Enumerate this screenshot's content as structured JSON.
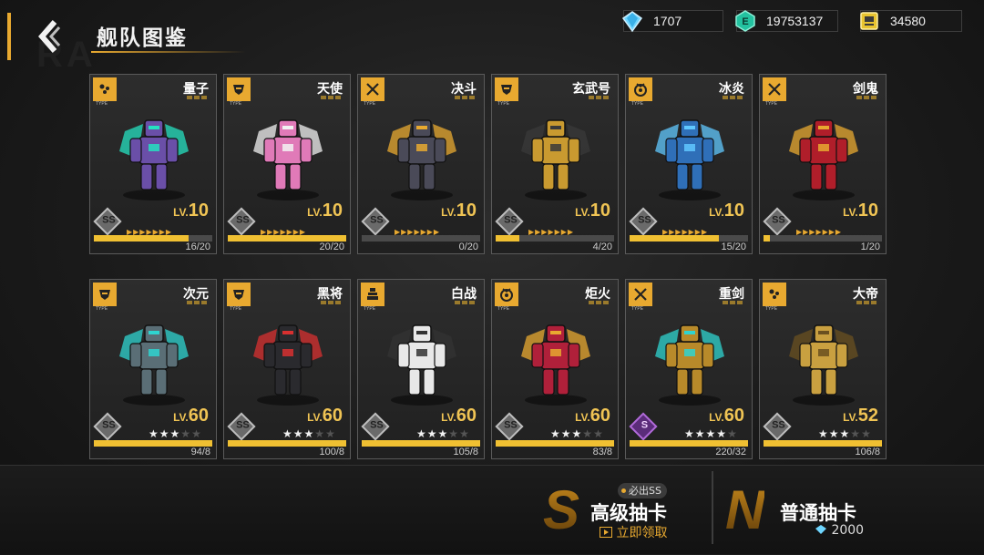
{
  "header": {
    "title": "舰队图鉴",
    "watermark": "RA"
  },
  "currencies": [
    {
      "icon": "diamond-icon",
      "value": "1707"
    },
    {
      "icon": "energy-coin-icon",
      "value": "19753137"
    },
    {
      "icon": "fuel-icon",
      "value": "34580"
    }
  ],
  "cards": [
    {
      "name": "量子",
      "type_icon": "dots-type-icon",
      "type_label": "TYPE",
      "rank": "SS",
      "lv_prefix": "LV.",
      "level": "10",
      "progress": "16/20",
      "fill": 0.8,
      "display": "chevrons",
      "mech_color": "#6a4fa8",
      "accent": "#25e0c0"
    },
    {
      "name": "天使",
      "type_icon": "helmet-type-icon",
      "type_label": "TYPE",
      "rank": "SS",
      "lv_prefix": "LV.",
      "level": "10",
      "progress": "20/20",
      "fill": 1.0,
      "display": "chevrons",
      "mech_color": "#e07ab8",
      "accent": "#f2f2f2"
    },
    {
      "name": "决斗",
      "type_icon": "swords-type-icon",
      "type_label": "TYPE",
      "rank": "SS",
      "lv_prefix": "LV.",
      "level": "10",
      "progress": "0/20",
      "fill": 0.0,
      "display": "chevrons",
      "mech_color": "#4a4a58",
      "accent": "#e8a930"
    },
    {
      "name": "玄武号",
      "type_icon": "helmet-type-icon",
      "type_label": "TYPE",
      "rank": "SS",
      "lv_prefix": "LV.",
      "level": "10",
      "progress": "4/20",
      "fill": 0.2,
      "display": "chevrons",
      "mech_color": "#c99a30",
      "accent": "#3a3a3a"
    },
    {
      "name": "冰炎",
      "type_icon": "shield-type-icon",
      "type_label": "TYPE",
      "rank": "SS",
      "lv_prefix": "LV.",
      "level": "10",
      "progress": "15/20",
      "fill": 0.75,
      "display": "chevrons",
      "mech_color": "#2f6fb8",
      "accent": "#60c8ff"
    },
    {
      "name": "剑鬼",
      "type_icon": "swords-type-icon",
      "type_label": "TYPE",
      "rank": "SS",
      "lv_prefix": "LV.",
      "level": "10",
      "progress": "1/20",
      "fill": 0.05,
      "display": "chevrons",
      "mech_color": "#b01e2a",
      "accent": "#e8a930"
    },
    {
      "name": "次元",
      "type_icon": "helmet-type-icon",
      "type_label": "TYPE",
      "rank": "SS",
      "lv_prefix": "LV.",
      "level": "60",
      "progress": "94/8",
      "fill": 1.0,
      "display": "stars",
      "stars": 3,
      "mech_color": "#5a6e76",
      "accent": "#2fd4d0"
    },
    {
      "name": "黑将",
      "type_icon": "helmet-type-icon",
      "type_label": "TYPE",
      "rank": "SS",
      "lv_prefix": "LV.",
      "level": "60",
      "progress": "100/8",
      "fill": 1.0,
      "display": "stars",
      "stars": 3,
      "mech_color": "#2a2a2e",
      "accent": "#d83030"
    },
    {
      "name": "白战",
      "type_icon": "tower-type-icon",
      "type_label": "TYPE",
      "rank": "SS",
      "lv_prefix": "LV.",
      "level": "60",
      "progress": "105/8",
      "fill": 1.0,
      "display": "stars",
      "stars": 3,
      "mech_color": "#e8e8e8",
      "accent": "#333333"
    },
    {
      "name": "炬火",
      "type_icon": "shield-type-icon",
      "type_label": "TYPE",
      "rank": "SS",
      "lv_prefix": "LV.",
      "level": "60",
      "progress": "83/8",
      "fill": 1.0,
      "display": "stars",
      "stars": 3,
      "mech_color": "#b0203a",
      "accent": "#e8a930"
    },
    {
      "name": "重剑",
      "type_icon": "swords-type-icon",
      "type_label": "TYPE",
      "rank": "S",
      "lv_prefix": "LV.",
      "level": "60",
      "progress": "220/32",
      "fill": 1.0,
      "display": "stars",
      "stars": 4,
      "mech_color": "#b88a2a",
      "accent": "#2fd4d0"
    },
    {
      "name": "大帝",
      "type_icon": "dots-type-icon",
      "type_label": "TYPE",
      "rank": "SS",
      "lv_prefix": "LV.",
      "level": "52",
      "progress": "106/8",
      "fill": 1.0,
      "display": "stars",
      "stars": 3,
      "mech_color": "#c9a040",
      "accent": "#6a5020"
    }
  ],
  "gacha": {
    "premium": {
      "letter": "S",
      "label": "高级抽卡",
      "badge": "必出SS",
      "sub_label": "立即领取"
    },
    "normal": {
      "letter": "N",
      "label": "普通抽卡",
      "cost": "2000"
    }
  }
}
